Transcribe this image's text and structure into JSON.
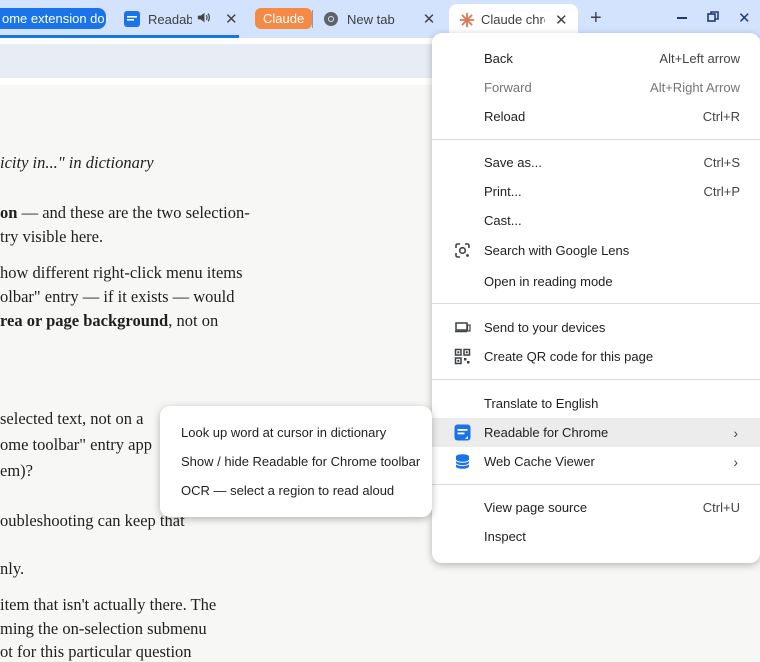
{
  "tabs": [
    {
      "title": "ome extension do"
    },
    {
      "title": "Readabl"
    },
    {
      "group": "Claude",
      "color": "#f48a44"
    },
    {
      "title": "New tab"
    },
    {
      "title": "Claude chro"
    }
  ],
  "window_controls": {
    "new_tab": "+",
    "minimize": "–",
    "close": "✕"
  },
  "article": {
    "lines": [
      {
        "text": "icity in...\" in dictionary",
        "style": "italic"
      },
      {
        "bold": "on",
        "text": " — and these are the two selection-"
      },
      {
        "text": "try visible here."
      },
      {
        "text": "how different right-click menu items"
      },
      {
        "text": "olbar\" entry — if it exists — would"
      },
      {
        "bold": "rea or page background",
        "text": ", not on"
      },
      {
        "text": " selected text, not on a"
      },
      {
        "text": "ome toolbar\" entry app"
      },
      {
        "text": "em)?"
      },
      {
        "text": "oubleshooting can keep that"
      },
      {
        "text": "nly."
      },
      {
        "text": " item that isn't actually there. The"
      },
      {
        "text": "ming the on-selection submenu"
      },
      {
        "text": "ot for this particular question"
      }
    ]
  },
  "context_menu": {
    "back": {
      "label": "Back",
      "shortcut": "Alt+Left arrow"
    },
    "forward": {
      "label": "Forward",
      "shortcut": "Alt+Right Arrow"
    },
    "reload": {
      "label": "Reload",
      "shortcut": "Ctrl+R"
    },
    "save_as": {
      "label": "Save as...",
      "shortcut": "Ctrl+S"
    },
    "print": {
      "label": "Print...",
      "shortcut": "Ctrl+P"
    },
    "cast": {
      "label": "Cast..."
    },
    "lens": {
      "label": "Search with Google Lens"
    },
    "reading_mode": {
      "label": "Open in reading mode"
    },
    "send": {
      "label": "Send to your devices"
    },
    "qr": {
      "label": "Create QR code for this page"
    },
    "translate": {
      "label": "Translate to English"
    },
    "readable": {
      "label": "Readable for Chrome"
    },
    "web_cache": {
      "label": "Web Cache Viewer"
    },
    "view_source": {
      "label": "View page source",
      "shortcut": "Ctrl+U"
    },
    "inspect": {
      "label": "Inspect"
    }
  },
  "submenu": {
    "items": [
      "Look up word at cursor in dictionary",
      "Show / hide Readable for Chrome toolbar",
      "OCR — select a region to read aloud"
    ]
  }
}
